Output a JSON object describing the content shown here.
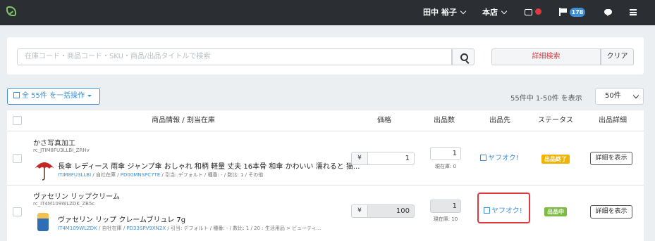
{
  "topbar": {
    "user_name": "田中 裕子",
    "store": "本店",
    "notification_count": "178",
    "accent_color": "#3d8fd6",
    "alert_color": "#e0383e"
  },
  "search": {
    "placeholder": "在庫コード・商品コード・SKU・商品/出品タイトルで検索",
    "advanced_label": "詳細検索",
    "clear_label": "クリア"
  },
  "toolbar": {
    "bulk_label": "全 55件 を一括操作",
    "count_text": "55件中 1-50件 を表示",
    "per_page": "50件"
  },
  "table": {
    "headers": [
      "商品情報 / 割当在庫",
      "価格",
      "出品数",
      "出品先",
      "ステータス",
      "出品詳細"
    ],
    "rows": [
      {
        "title": "かさ写真加工",
        "code": "rc_JTIM8FU3LLBI_ZRHv",
        "name": "長傘 レディース 雨傘 ジャンプ傘 おしゃれ 和柄 軽量 丈夫 16本骨 和傘 かわいい 濡れると 猫...",
        "meta_prefix": "",
        "meta_link1": "ITIM8FU3LLBI",
        "meta_mid": " / 自社在庫 / ",
        "meta_link2": "PD00MNSPC7TE",
        "meta_rest": " / 引当: デフォルト / 種番: - / 数比: 1 / その他",
        "currency": "¥",
        "price": "1",
        "qty": "1",
        "stock": "現在庫: 0",
        "channel": "ヤフオク!",
        "status": "出品終了",
        "status_color": "#f0b400",
        "detail_label": "詳細を表示"
      },
      {
        "title": "ヴァセリン リップクリーム",
        "code": "rc_IT4M109WLZDK_ZB5c",
        "name": "ヴァセリン リップ クレームブリュレ 7g",
        "meta_prefix": "",
        "meta_link1": "IT4M109WLZDK",
        "meta_mid": " / 自社在庫 / ",
        "meta_link2": "PD33SPV9XN2X",
        "meta_rest": " / 引当: デフォルト / 種番: - / 数比: 1 / 20 : 生活用品 > ビューティ...",
        "currency": "¥",
        "price": "100",
        "qty": "1",
        "stock": "現在庫: 10",
        "channel": "ヤフオク!",
        "status": "出品中",
        "status_color": "#7dbb42",
        "detail_label": "詳細を表示"
      }
    ]
  },
  "icons": [
    "logo-icon",
    "chevron-down-icon",
    "printer-icon",
    "flag-icon",
    "chat-icon",
    "menu-icon",
    "search-icon",
    "edit-icon",
    "external-link-icon",
    "umbrella-icon"
  ]
}
